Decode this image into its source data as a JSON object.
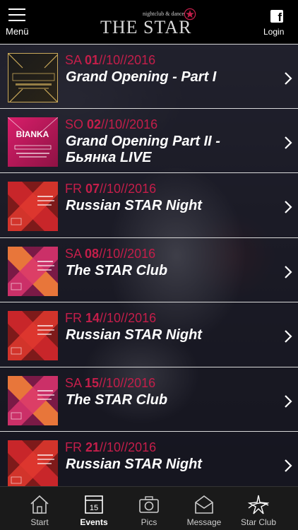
{
  "header": {
    "menu_label": "Menü",
    "logo_tagline": "nightclub & dance",
    "logo_title": "THE STAR",
    "login_label": "Login",
    "accent": "#c41e4a"
  },
  "events": [
    {
      "day": "SA",
      "dd": "01",
      "rest": "//10//2016",
      "title": "Grand Opening - Part I",
      "thumb": "gold-art-deco"
    },
    {
      "day": "SO",
      "dd": "02",
      "rest": "//10//2016",
      "title": "Grand Opening Part II - Бьянка LIVE",
      "thumb": "pink-bianka"
    },
    {
      "day": "FR",
      "dd": "07",
      "rest": "//10//2016",
      "title": "Russian STAR Night",
      "thumb": "red-x"
    },
    {
      "day": "SA",
      "dd": "08",
      "rest": "//10//2016",
      "title": "The STAR Club",
      "thumb": "orange-pink-x"
    },
    {
      "day": "FR",
      "dd": "14",
      "rest": "//10//2016",
      "title": "Russian STAR Night",
      "thumb": "red-x"
    },
    {
      "day": "SA",
      "dd": "15",
      "rest": "//10//2016",
      "title": "The STAR Club",
      "thumb": "orange-pink-x"
    },
    {
      "day": "FR",
      "dd": "21",
      "rest": "//10//2016",
      "title": "Russian STAR Night",
      "thumb": "red-x"
    }
  ],
  "tabs": [
    {
      "label": "Start",
      "icon": "house-icon"
    },
    {
      "label": "Events",
      "icon": "calendar-icon",
      "icon_text": "15",
      "active": true
    },
    {
      "label": "Pics",
      "icon": "camera-icon"
    },
    {
      "label": "Message",
      "icon": "envelope-icon"
    },
    {
      "label": "Star Club",
      "icon": "star-club-icon"
    }
  ]
}
